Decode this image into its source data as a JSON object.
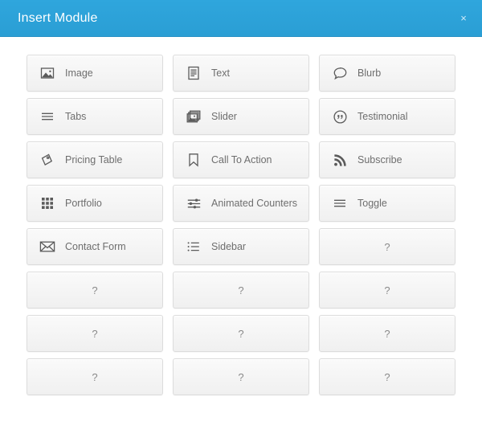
{
  "header": {
    "title": "Insert Module",
    "close_label": "×",
    "accent_color": "#2ea3da",
    "title_color": "#ffffff"
  },
  "modules": [
    {
      "label": "Image",
      "icon": "image-icon",
      "placeholder": false
    },
    {
      "label": "Text",
      "icon": "document-text-icon",
      "placeholder": false
    },
    {
      "label": "Blurb",
      "icon": "speech-bubble-icon",
      "placeholder": false
    },
    {
      "label": "Tabs",
      "icon": "hamburger-lines-icon",
      "placeholder": false
    },
    {
      "label": "Slider",
      "icon": "stacked-images-icon",
      "placeholder": false
    },
    {
      "label": "Testimonial",
      "icon": "quote-circle-icon",
      "placeholder": false
    },
    {
      "label": "Pricing Table",
      "icon": "price-tag-icon",
      "placeholder": false
    },
    {
      "label": "Call To Action",
      "icon": "bookmark-icon",
      "placeholder": false
    },
    {
      "label": "Subscribe",
      "icon": "rss-feed-icon",
      "placeholder": false
    },
    {
      "label": "Portfolio",
      "icon": "grid-squares-icon",
      "placeholder": false
    },
    {
      "label": "Animated Counters",
      "icon": "sliders-icon",
      "placeholder": false
    },
    {
      "label": "Toggle",
      "icon": "hamburger-lines-icon",
      "placeholder": false
    },
    {
      "label": "Contact Form",
      "icon": "envelope-icon",
      "placeholder": false
    },
    {
      "label": "Sidebar",
      "icon": "bullet-list-icon",
      "placeholder": false
    },
    {
      "label": "?",
      "icon": null,
      "placeholder": true
    },
    {
      "label": "?",
      "icon": null,
      "placeholder": true
    },
    {
      "label": "?",
      "icon": null,
      "placeholder": true
    },
    {
      "label": "?",
      "icon": null,
      "placeholder": true
    },
    {
      "label": "?",
      "icon": null,
      "placeholder": true
    },
    {
      "label": "?",
      "icon": null,
      "placeholder": true
    },
    {
      "label": "?",
      "icon": null,
      "placeholder": true
    },
    {
      "label": "?",
      "icon": null,
      "placeholder": true
    },
    {
      "label": "?",
      "icon": null,
      "placeholder": true
    },
    {
      "label": "?",
      "icon": null,
      "placeholder": true
    }
  ]
}
